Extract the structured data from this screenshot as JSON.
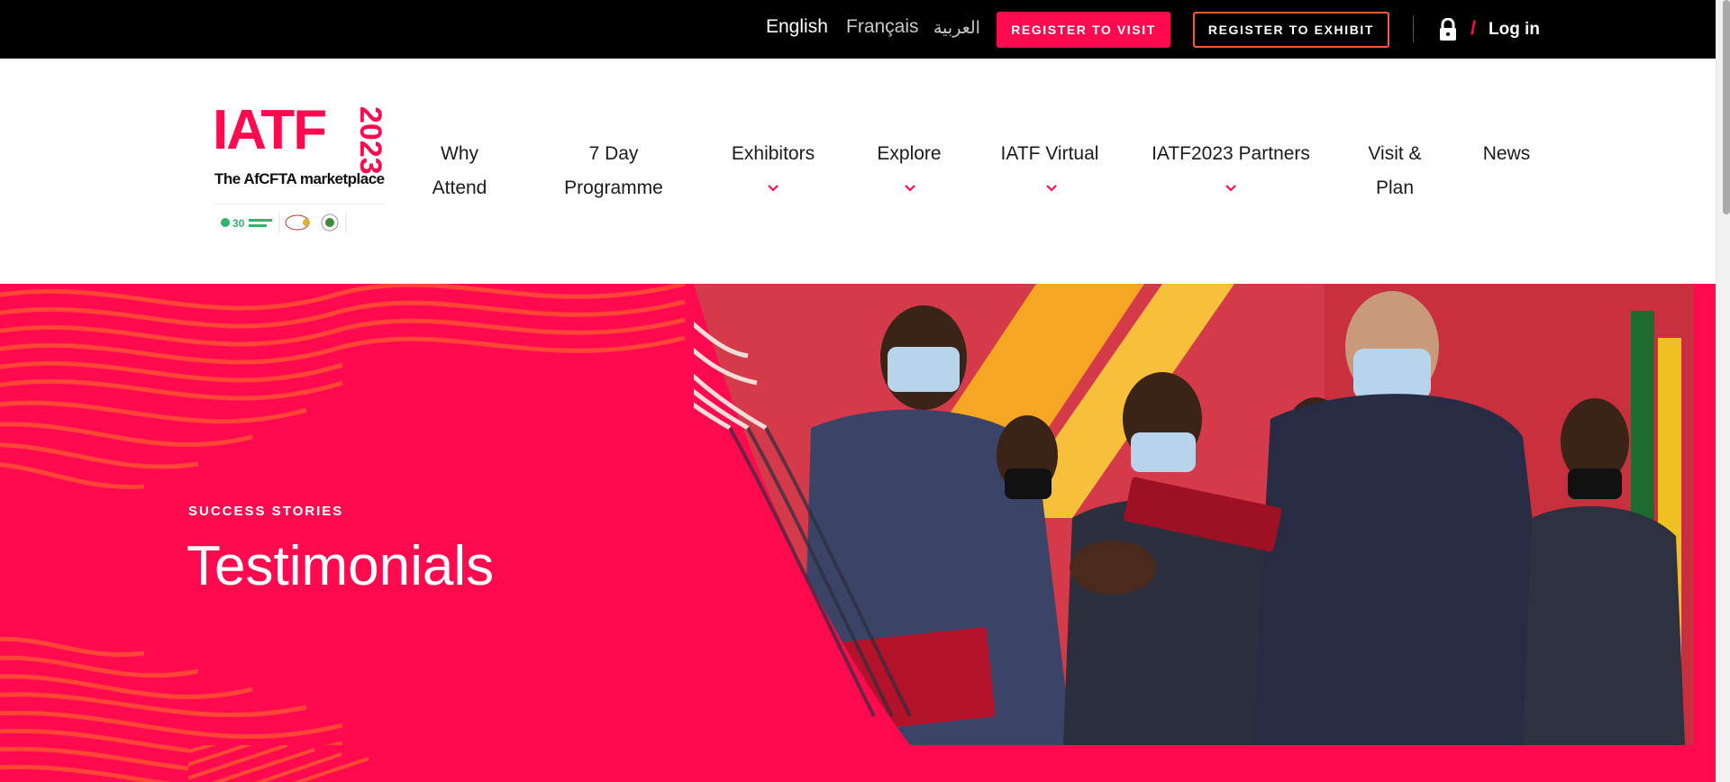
{
  "topbar": {
    "languages": [
      {
        "label": "English"
      },
      {
        "label": "Français"
      },
      {
        "label": "العربية"
      }
    ],
    "register_visit": "REGISTER TO VISIT",
    "register_exhibit": "REGISTER TO EXHIBIT",
    "slash": "/",
    "login": "Log in",
    "icons": [
      "lock-icon"
    ]
  },
  "logo": {
    "wordmark": "IATF",
    "year": "2023",
    "tagline": "The AfCFTA marketplace"
  },
  "nav": {
    "items": [
      {
        "line1": "Why",
        "line2": "Attend",
        "has_dropdown": false
      },
      {
        "line1": "7 Day",
        "line2": "Programme",
        "has_dropdown": false
      },
      {
        "line1": "Exhibitors",
        "line2": "",
        "has_dropdown": true
      },
      {
        "line1": "Explore",
        "line2": "",
        "has_dropdown": true
      },
      {
        "line1": "IATF Virtual",
        "line2": "",
        "has_dropdown": true
      },
      {
        "line1": "IATF2023 Partners",
        "line2": "",
        "has_dropdown": true
      },
      {
        "line1": "Visit &",
        "line2": "Plan",
        "has_dropdown": false
      },
      {
        "line1": "News",
        "line2": "",
        "has_dropdown": false
      }
    ]
  },
  "hero": {
    "eyebrow": "SUCCESS STORIES",
    "title": "Testimonials"
  },
  "colors": {
    "brand": "#ff0a4f",
    "accent_orange": "#ff5a2e",
    "topbar": "#000000"
  }
}
